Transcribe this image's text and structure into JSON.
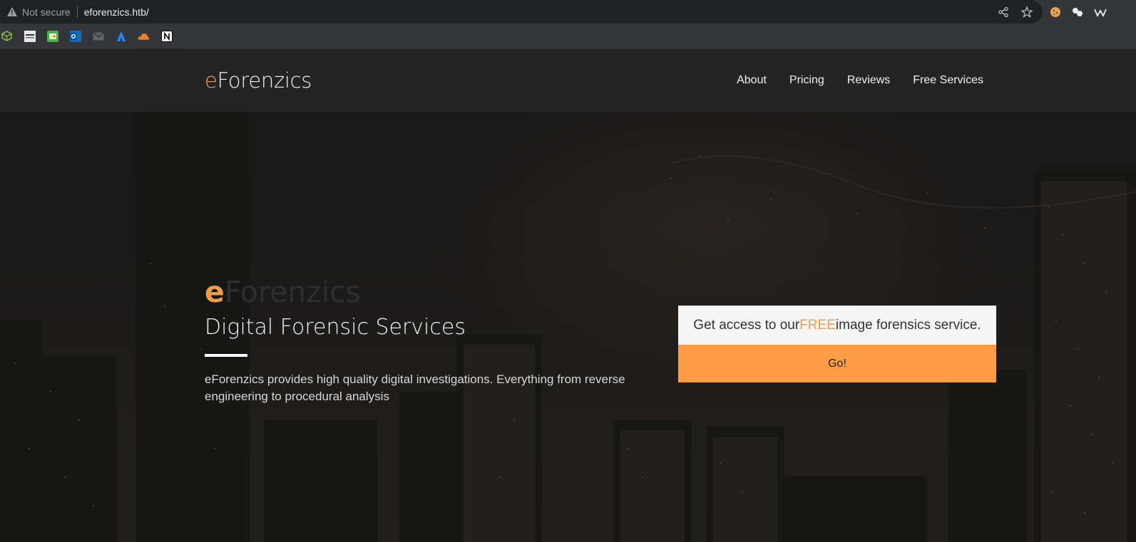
{
  "browser": {
    "security_label": "Not secure",
    "url": "eforenzics.htb/",
    "bookmarks": [
      "cube-bookmark-icon",
      "bank-bookmark-icon",
      "green-app-bookmark-icon",
      "outlook-bookmark-icon",
      "mail-bookmark-icon",
      "atlassian-bookmark-icon",
      "cloud-bookmark-icon",
      "notion-bookmark-icon"
    ]
  },
  "site": {
    "brand_prefix": "e",
    "brand_rest": "Forenzics",
    "nav": [
      "About",
      "Pricing",
      "Reviews",
      "Free Services"
    ],
    "hero": {
      "brand_prefix": "e",
      "brand_rest": "Forenzics",
      "title": "Digital Forensic Services",
      "description": "eForenzics provides high quality digital investigations. Everything from reverse engineering to procedural analysis"
    },
    "cta": {
      "text_before": "Get access to our ",
      "highlight": "FREE",
      "text_after": " image forensics service.",
      "button": "Go!"
    }
  },
  "colors": {
    "accent": "#ff9c45",
    "brand_e": "#f19c4b"
  }
}
